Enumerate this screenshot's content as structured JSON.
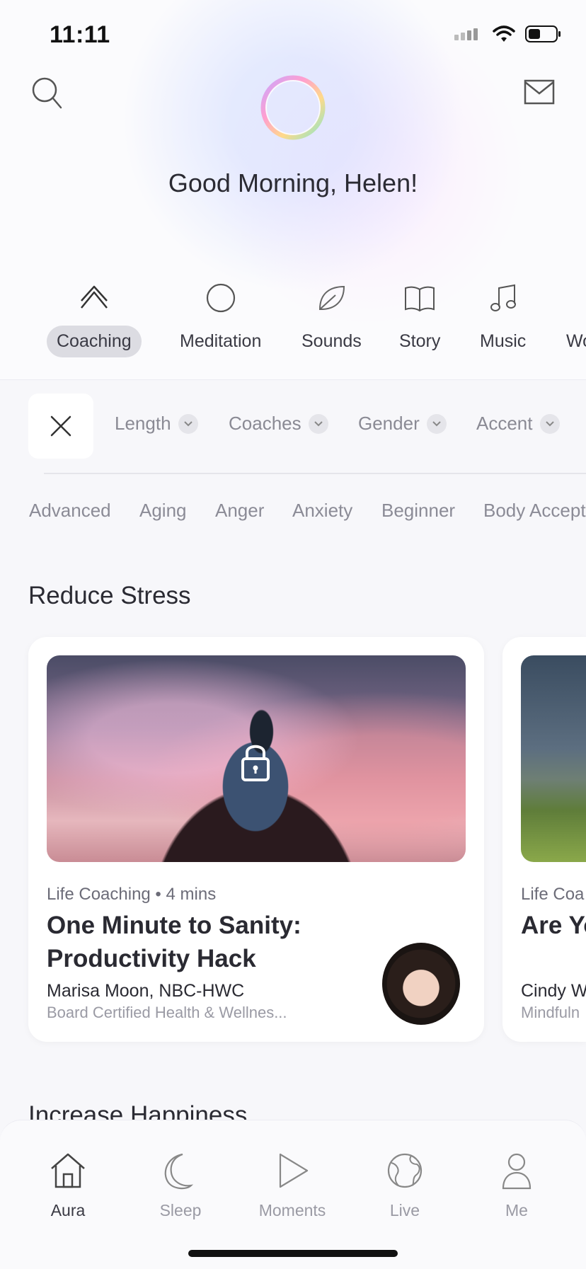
{
  "status_bar": {
    "time": "11:11"
  },
  "header": {
    "greeting": "Good Morning, Helen!",
    "search_icon": "search-icon",
    "mail_icon": "mail-icon",
    "logo": "aura-ring-logo"
  },
  "categories": [
    {
      "label": "Coaching",
      "icon": "crown-icon",
      "active": true
    },
    {
      "label": "Meditation",
      "icon": "circle-icon",
      "active": false
    },
    {
      "label": "Sounds",
      "icon": "leaf-icon",
      "active": false
    },
    {
      "label": "Story",
      "icon": "book-icon",
      "active": false
    },
    {
      "label": "Music",
      "icon": "music-note-icon",
      "active": false
    },
    {
      "label": "Wo",
      "icon": "",
      "active": false
    }
  ],
  "filters": [
    {
      "label": "Length"
    },
    {
      "label": "Coaches"
    },
    {
      "label": "Gender"
    },
    {
      "label": "Accent"
    }
  ],
  "tags": [
    "Advanced",
    "Aging",
    "Anger",
    "Anxiety",
    "Beginner",
    "Body Accept"
  ],
  "sections": [
    {
      "title": "Reduce Stress",
      "cards": [
        {
          "meta": "Life Coaching • 4 mins",
          "title": "One Minute to Sanity: Productivity Hack",
          "coach": "Marisa Moon, NBC-HWC",
          "coach_title": "Board Certified Health & Wellnes...",
          "locked": true
        },
        {
          "meta": "Life Coa",
          "title": "Are Yo",
          "coach": "Cindy W",
          "coach_title": "Mindfuln"
        }
      ]
    },
    {
      "title": "Increase Happiness"
    }
  ],
  "bottom_nav": [
    {
      "label": "Aura",
      "icon": "home-icon",
      "active": true
    },
    {
      "label": "Sleep",
      "icon": "moon-icon",
      "active": false
    },
    {
      "label": "Moments",
      "icon": "play-icon",
      "active": false
    },
    {
      "label": "Live",
      "icon": "globe-icon",
      "active": false
    },
    {
      "label": "Me",
      "icon": "person-icon",
      "active": false
    }
  ]
}
